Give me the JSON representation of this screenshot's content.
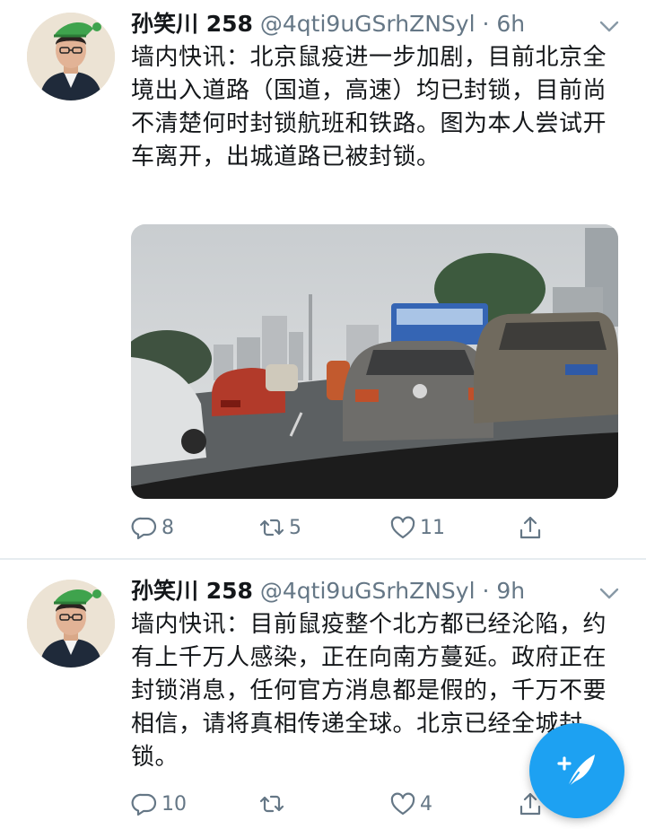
{
  "tweets": [
    {
      "display_name": "孙笑川 258",
      "handle": "@4qti9uGSrhZNSyl · 6h",
      "text": "墙内快讯：北京鼠疫进一步加剧，目前北京全境出入道路（国道，高速）均已封锁，目前尚不清楚何时封锁航班和铁路。图为本人尝试开车离开，出城道路已被封锁。",
      "media_icon": "photo-traffic-jam",
      "replies": "8",
      "retweets": "5",
      "likes": "11"
    },
    {
      "display_name": "孙笑川 258",
      "handle": "@4qti9uGSrhZNSyl · 9h",
      "text": "墙内快讯：目前鼠疫整个北方都已经沦陷，约有上千万人感染，正在向南方蔓延。政府正在封锁消息，任何官方消息都是假的，千万不要相信，请将真相传递全球。北京已经全城封锁。",
      "replies": "10",
      "retweets": "",
      "likes": "4"
    }
  ],
  "icons": {
    "reply": "reply-icon",
    "retweet": "retweet-icon",
    "like": "heart-icon",
    "share": "share-icon",
    "more": "chevron-down-icon",
    "compose": "compose-feather-icon"
  },
  "colors": {
    "accent": "#1da1f2",
    "text": "#14171a",
    "secondary": "#657786",
    "separator": "#e6ecf0"
  }
}
